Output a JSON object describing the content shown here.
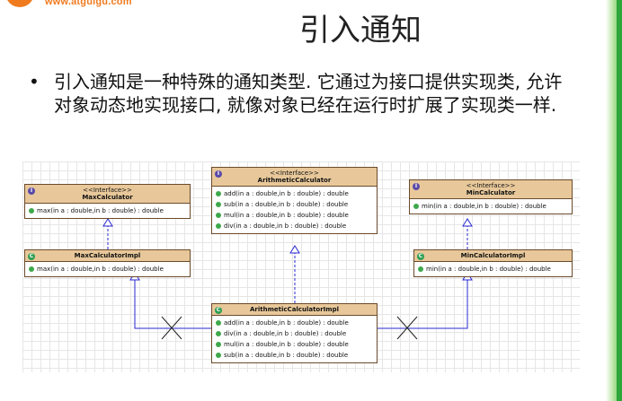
{
  "header": {
    "logo_text": "www.atguigu.com",
    "title": "引入通知"
  },
  "bullet": {
    "dot": "•",
    "text": "引入通知是一种特殊的通知类型. 它通过为接口提供实现类, 允许对象动态地实现接口, 就像对象已经在运行时扩展了实现类一样."
  },
  "diagram": {
    "max_interface": {
      "stereotype": "<<Interface>>",
      "name": "MaxCalculator",
      "ops": [
        "max(in a : double,in b : double) : double"
      ]
    },
    "max_impl": {
      "name": "MaxCalculatorImpl",
      "ops": [
        "max(in a : double,in b : double) : double"
      ]
    },
    "arith_interface": {
      "stereotype": "<<Interface>>",
      "name": "ArithmeticCalculator",
      "ops": [
        "add(in a : double,in b : double) : double",
        "sub(in a : double,in b : double) : double",
        "mul(in a : double,in b : double) : double",
        "div(in a : double,in b : double) : double"
      ]
    },
    "arith_impl": {
      "name": "ArithmeticCalculatorImpl",
      "ops": [
        "add(in a : double,in b : double) : double",
        "div(in a : double,in b : double) : double",
        "mul(in a : double,in b : double) : double",
        "sub(in a : double,in b : double) : double"
      ]
    },
    "min_interface": {
      "stereotype": "<<Interface>>",
      "name": "MinCalculator",
      "ops": [
        "min(in a : double,in b : double) : double"
      ]
    },
    "min_impl": {
      "name": "MinCalculatorImpl",
      "ops": [
        "min(in a : double,in b : double) : double"
      ]
    },
    "badge_interface": "I",
    "badge_class": "C"
  }
}
